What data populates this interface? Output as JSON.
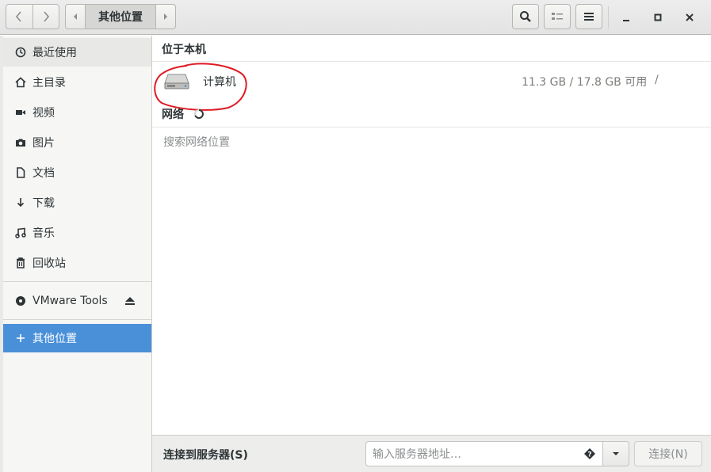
{
  "header": {
    "path_label": "其他位置"
  },
  "sidebar": {
    "items": [
      {
        "label": "最近使用",
        "icon": "clock-icon"
      },
      {
        "label": "主目录",
        "icon": "home-icon"
      },
      {
        "label": "视频",
        "icon": "video-icon"
      },
      {
        "label": "图片",
        "icon": "camera-icon"
      },
      {
        "label": "文档",
        "icon": "document-icon"
      },
      {
        "label": "下载",
        "icon": "download-icon"
      },
      {
        "label": "音乐",
        "icon": "music-icon"
      },
      {
        "label": "回收站",
        "icon": "trash-icon"
      }
    ],
    "device": {
      "label": "VMware Tools",
      "icon": "disc-icon"
    },
    "other": {
      "label": "其他位置",
      "icon": "plus-icon"
    }
  },
  "main": {
    "local_title": "位于本机",
    "computer": {
      "name": "计算机",
      "size": "11.3 GB / 17.8 GB 可用",
      "mount": "/"
    },
    "network_title": "网络",
    "network_placeholder": "搜索网络位置"
  },
  "bottom": {
    "connect_label": "连接到服务器(S)",
    "input_placeholder": "输入服务器地址…",
    "connect_button": "连接(N)"
  },
  "colors": {
    "accent": "#4a90d9",
    "annotation": "#e01b24"
  }
}
